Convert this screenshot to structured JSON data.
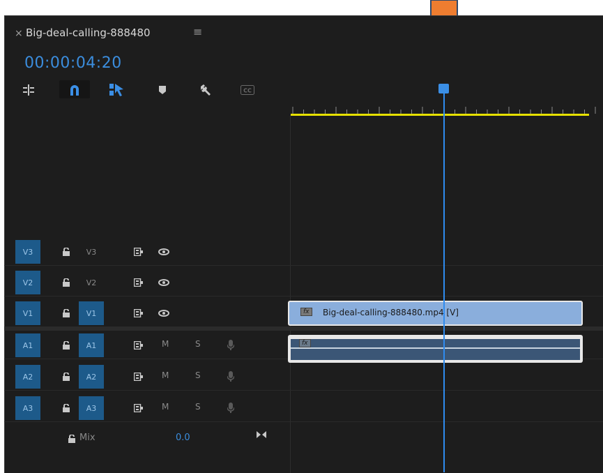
{
  "sequence": {
    "close_glyph": "×",
    "title": "Big-deal-calling-888480",
    "menu_glyph": "≡",
    "timecode": "00:00:04:20"
  },
  "toolbar": {
    "icons": [
      "insert-edit-icon",
      "snap-magnet-icon",
      "linked-selection-icon",
      "add-marker-icon",
      "wrench-settings-icon",
      "captions-icon"
    ],
    "captions_label": "CC"
  },
  "tracks": {
    "video": [
      {
        "source": "V3",
        "target": "V3",
        "target_highlighted": false
      },
      {
        "source": "V2",
        "target": "V2",
        "target_highlighted": false
      },
      {
        "source": "V1",
        "target": "V1",
        "target_highlighted": true
      }
    ],
    "audio": [
      {
        "source": "A1",
        "target": "A1",
        "mute": "M",
        "solo": "S"
      },
      {
        "source": "A2",
        "target": "A2",
        "mute": "M",
        "solo": "S"
      },
      {
        "source": "A3",
        "target": "A3",
        "mute": "M",
        "solo": "S"
      }
    ],
    "mix": {
      "label": "Mix",
      "value": "0.0"
    }
  },
  "clips": {
    "video_clip_label": "Big-deal-calling-888480.mp4 [V]",
    "fx_label": "fx"
  },
  "colors": {
    "accent_blue": "#3b8ddd",
    "track_target_blue": "#1d5a8a",
    "work_area_yellow": "#e6e000",
    "annotation_arrow": "#ee7d30",
    "video_clip": "#8aaedc",
    "audio_clip": "#3b5676"
  }
}
